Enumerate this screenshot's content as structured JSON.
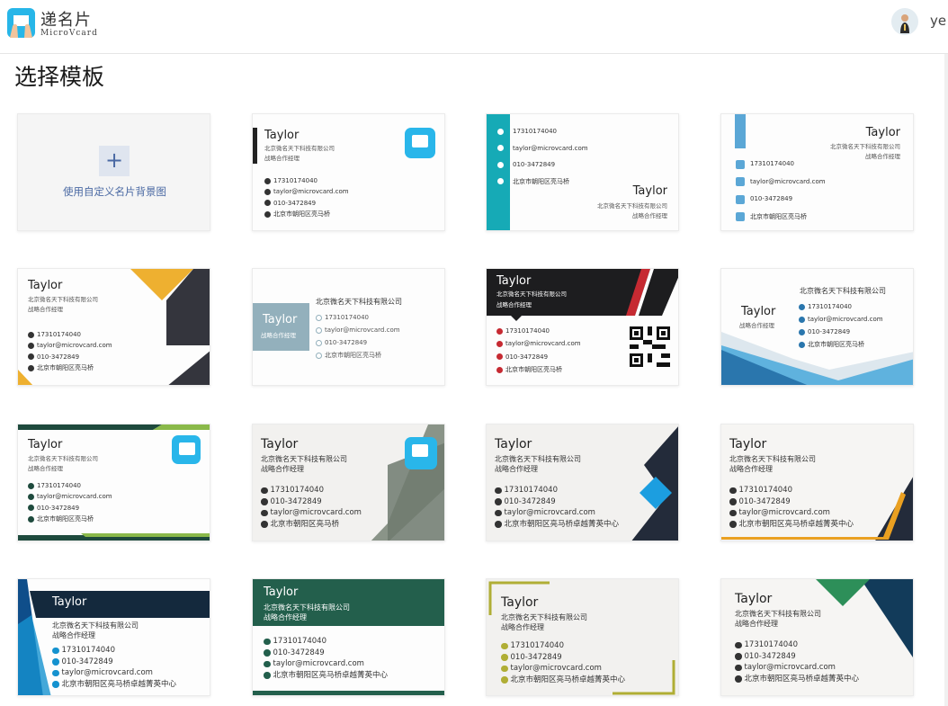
{
  "app": {
    "name": "递名片",
    "subtitle": "MicroVcard",
    "user": "ye"
  },
  "page_title": "选择模板",
  "custom": {
    "plus": "+",
    "label": "使用自定义名片背景图"
  },
  "person": {
    "name": "Taylor",
    "company": "北京微名天下科技有限公司",
    "title": "战略合作经理",
    "phone": "17310174040",
    "email": "taylor@microvcard.com",
    "tel": "010-3472849",
    "addr": "北京市朝阳区亮马桥",
    "addr_long": "北京市朝阳区亮马桥卓越菁英中心"
  },
  "colors": {
    "accent": "#4a69a3",
    "brand_blue": "#27b6e8"
  },
  "icons": [
    "logo-icon",
    "avatar-icon",
    "plus-icon",
    "phone-icon",
    "email-icon",
    "tel-icon",
    "location-icon",
    "app-icon",
    "qr-code-icon"
  ]
}
